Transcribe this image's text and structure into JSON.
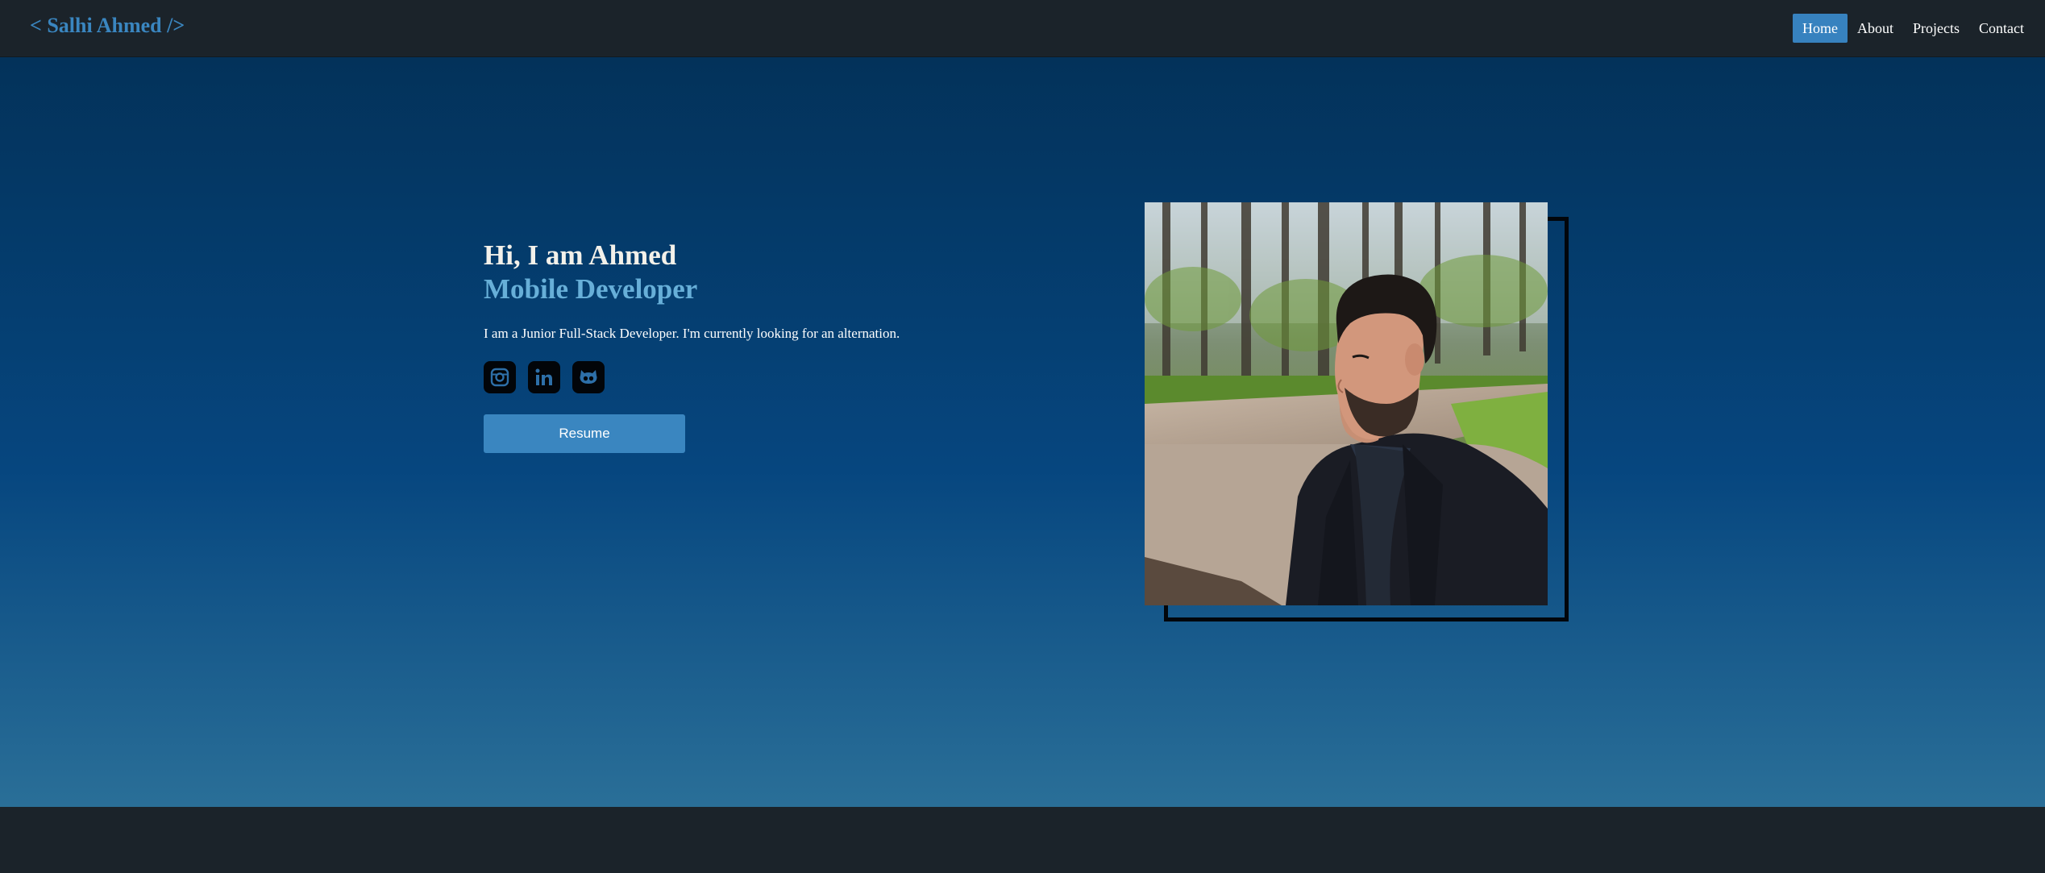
{
  "navbar": {
    "brand": "< Salhi Ahmed />",
    "links": [
      {
        "label": "Home",
        "active": true
      },
      {
        "label": "About",
        "active": false
      },
      {
        "label": "Projects",
        "active": false
      },
      {
        "label": "Contact",
        "active": false
      }
    ]
  },
  "hero": {
    "greeting": "Hi, I am Ahmed",
    "role": "Mobile Developer",
    "description": "I am a Junior Full-Stack Developer. I'm currently looking for an alternation.",
    "socials": [
      {
        "icon": "instagram-icon"
      },
      {
        "icon": "linkedin-icon"
      },
      {
        "icon": "github-icon"
      }
    ],
    "resume_label": "Resume"
  },
  "colors": {
    "brand": "#3a86c0",
    "accent": "#67afd8",
    "nav_active": "#3782bf",
    "navbar_bg": "#1b232a",
    "hero_top": "#03325a",
    "hero_bottom": "#2a6f98"
  }
}
